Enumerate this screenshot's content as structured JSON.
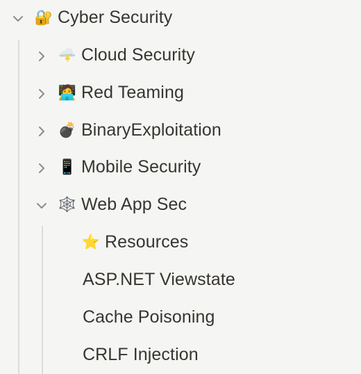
{
  "tree": {
    "root": {
      "label": "Cyber Security",
      "icon": "🔐",
      "expanded": true
    },
    "children": [
      {
        "label": "Cloud Security",
        "icon": "🌩️",
        "expanded": false
      },
      {
        "label": "Red Teaming",
        "icon": "🧑‍💻",
        "expanded": false
      },
      {
        "label": "BinaryExploitation",
        "icon": "💣",
        "expanded": false
      },
      {
        "label": "Mobile Security",
        "icon": "📱",
        "expanded": false
      },
      {
        "label": "Web App Sec",
        "icon": "🕸️",
        "expanded": true
      }
    ],
    "web_app_sec_children": [
      {
        "label": "Resources",
        "icon": "⭐"
      },
      {
        "label": "ASP.NET Viewstate"
      },
      {
        "label": "Cache Poisoning"
      },
      {
        "label": "CRLF Injection"
      }
    ]
  }
}
